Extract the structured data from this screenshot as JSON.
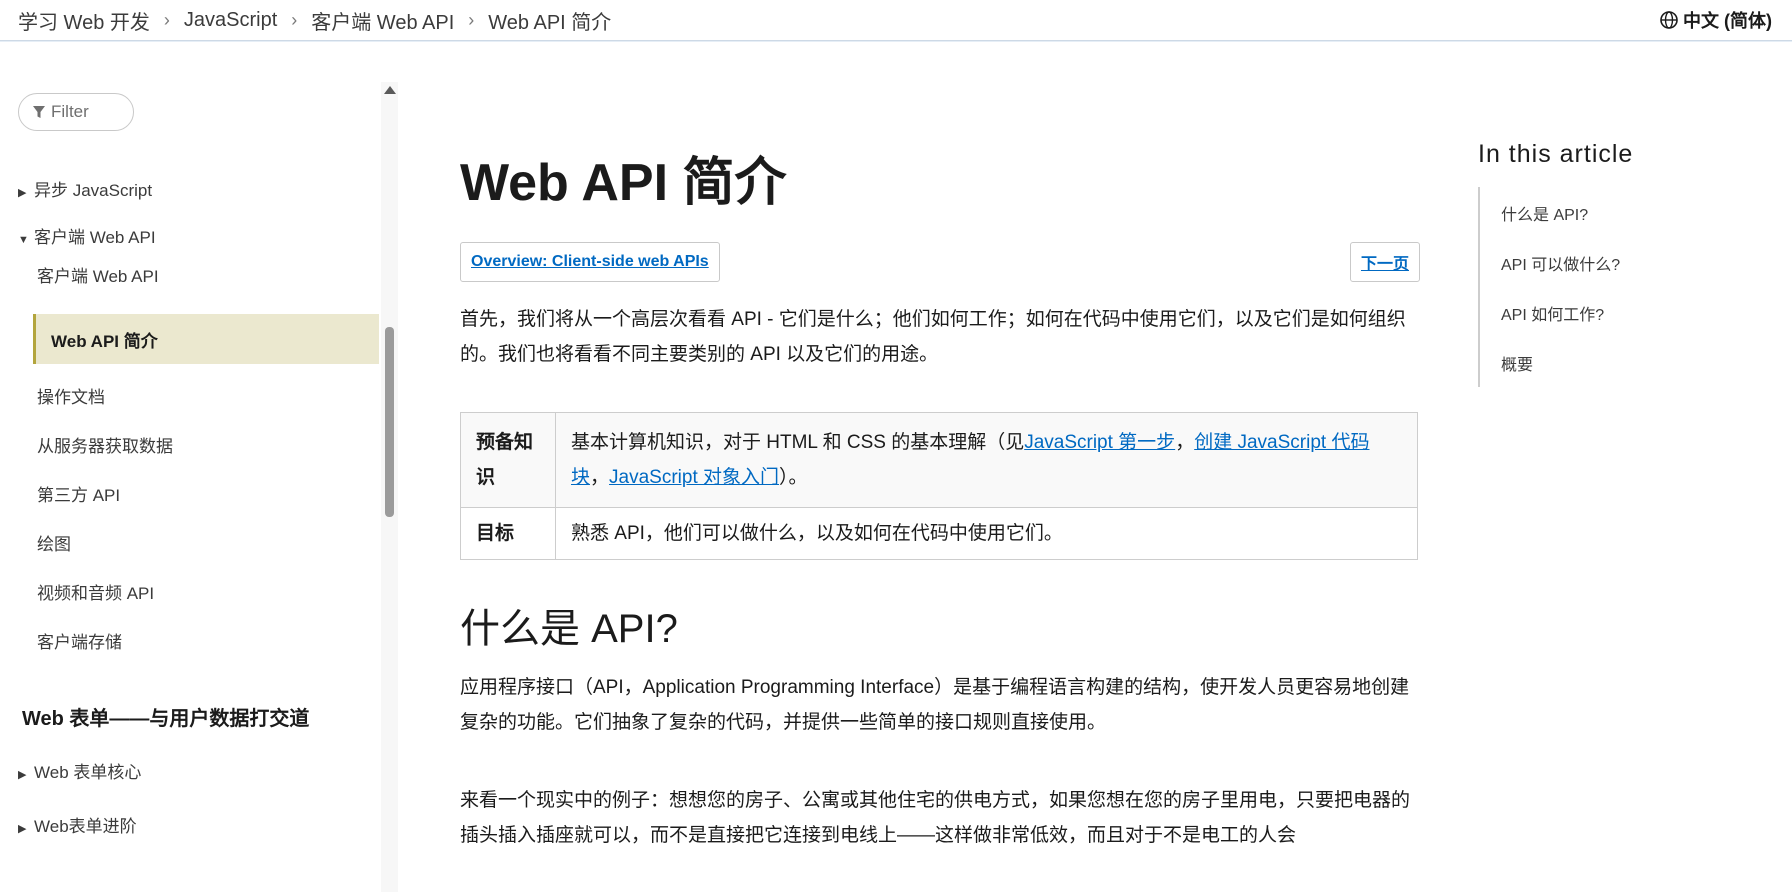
{
  "breadcrumb": {
    "items": [
      "学习 Web 开发",
      "JavaScript",
      "客户端 Web API",
      "Web API 简介"
    ]
  },
  "language": {
    "label": "中文 (简体)"
  },
  "sidebar": {
    "filter_placeholder": "Filter",
    "items": [
      {
        "label": "异步 JavaScript",
        "expanded": false
      },
      {
        "label": "客户端 Web API",
        "expanded": true
      },
      {
        "label": "客户端 Web API"
      },
      {
        "label": "Web API 简介",
        "active": true
      },
      {
        "label": "操作文档"
      },
      {
        "label": "从服务器获取数据"
      },
      {
        "label": "第三方 API"
      },
      {
        "label": "绘图"
      },
      {
        "label": "视频和音频 API"
      },
      {
        "label": "客户端存储"
      }
    ],
    "section_heading": "Web 表单——与用户数据打交道",
    "section_items": [
      {
        "label": "Web 表单核心",
        "expanded": false
      },
      {
        "label": "Web表单进阶",
        "expanded": false
      }
    ]
  },
  "article": {
    "title": "Web API 简介",
    "overview_button": "Overview: Client-side web APIs",
    "next_button": "下一页",
    "intro": "首先，我们将从一个高层次看看 API - 它们是什么；他们如何工作；如何在代码中使用它们，以及它们是如何组织的。我们也将看看不同主要类别的 API 以及它们的用途。",
    "prereq": {
      "row1_label": "预备知识",
      "row1_text_before": "基本计算机知识，对于 HTML 和 CSS 的基本理解（见",
      "link1": "JavaScript 第一步",
      "sep1": "，",
      "link2": "创建 JavaScript 代码块",
      "sep2": "，",
      "link3": "JavaScript 对象入门",
      "row1_text_after": "）。",
      "row2_label": "目标",
      "row2_text": "熟悉 API，他们可以做什么，以及如何在代码中使用它们。"
    },
    "section1_heading": "什么是 API?",
    "section1_p1": "应用程序接口（API，Application Programming Interface）是基于编程语言构建的结构，使开发人员更容易地创建复杂的功能。它们抽象了复杂的代码，并提供一些简单的接口规则直接使用。",
    "section1_p2": "来看一个现实中的例子：想想您的房子、公寓或其他住宅的供电方式，如果您想在您的房子里用电，只要把电器的插头插入插座就可以，而不是直接把它连接到电线上——这样做非常低效，而且对于不是电工的人会"
  },
  "toc": {
    "title": "In this article",
    "items": [
      "什么是 API?",
      "API 可以做什么?",
      "API 如何工作?",
      "概要"
    ]
  }
}
